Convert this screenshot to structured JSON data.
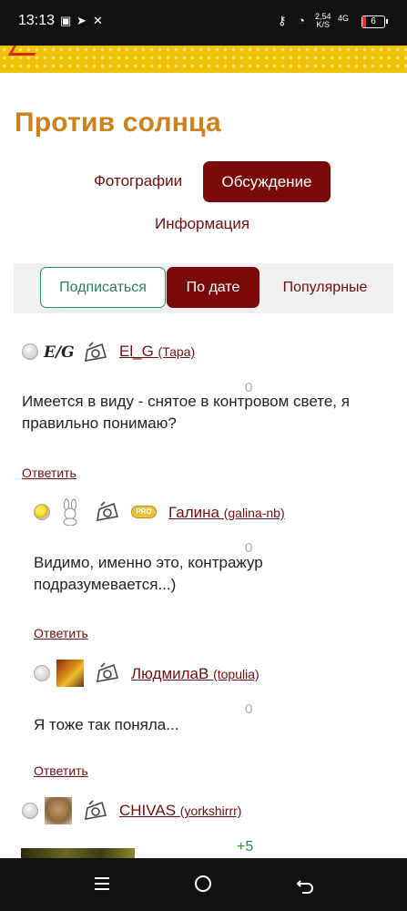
{
  "status_bar": {
    "time": "13:13",
    "speed_value": "2,54",
    "speed_unit": "K/S",
    "network": "4G",
    "battery": "6"
  },
  "page": {
    "title": "Против солнца"
  },
  "tabs": {
    "photos": "Фотографии",
    "discussion": "Обсуждение",
    "info": "Информация"
  },
  "filters": {
    "subscribe": "Подписаться",
    "by_date": "По дате",
    "popular": "Популярные"
  },
  "comments": [
    {
      "user": "El_G",
      "login": "(Тара)",
      "avatar_text": "E/G",
      "score": "0",
      "text": "Имеется в виду - снятое в контровом свете, я правильно понимаю?",
      "reply": "Ответить"
    },
    {
      "user": "Галина",
      "login": "(galina-nb)",
      "badge": "PRO",
      "score": "0",
      "text": "Видимо, именно это, контражур подразумевается...)",
      "reply": "Ответить"
    },
    {
      "user": "ЛюдмилаВ",
      "login": "(topulia)",
      "score": "0",
      "text": "Я тоже так поняла...",
      "reply": "Ответить"
    },
    {
      "user": "CHIVAS",
      "login": "(yorkshirrr)",
      "score": "+5"
    }
  ],
  "colors": {
    "title": "#c9821c",
    "accent": "#7a0a0a",
    "link": "#6b0f0f",
    "subscribe": "#2e8b64"
  }
}
